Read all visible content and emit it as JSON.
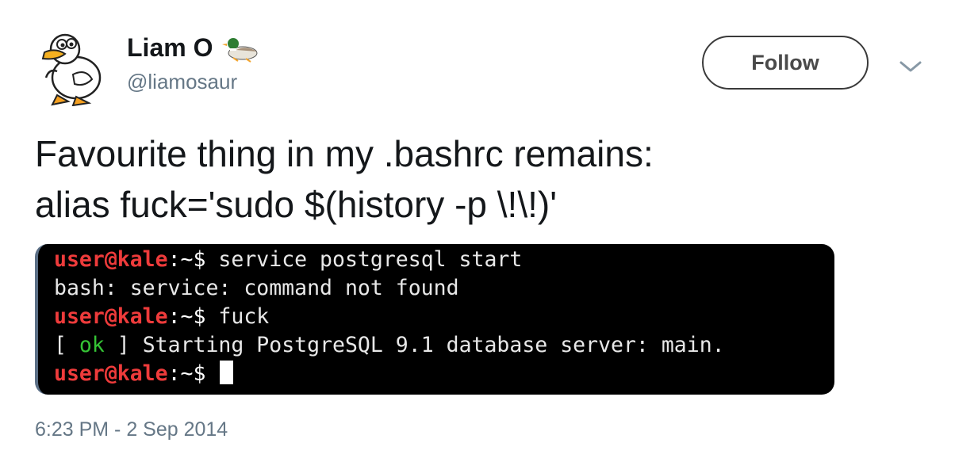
{
  "author": {
    "name": "Liam O",
    "handle": "@liamosaur",
    "avatar_icon": "cartoon-duck-avatar",
    "name_emoji_icon": "duck-emoji-icon"
  },
  "actions": {
    "follow_label": "Follow",
    "more_icon": "chevron-down-icon"
  },
  "tweet": {
    "line1": "Favourite thing in my .bashrc remains:",
    "line2": "alias fuck='sudo $(history -p \\!\\!)'"
  },
  "terminal": {
    "prompt_user": "user@kale",
    "prompt_path": ":~$",
    "line1_cmd": " service postgresql start",
    "line2_out": "bash: service: command not found",
    "line3_cmd": " fuck",
    "line4_open": "[ ",
    "line4_ok": "ok",
    "line4_rest": " ] Starting PostgreSQL 9.1 database server: main.",
    "colors": {
      "user": "#ee3b3b",
      "ok": "#35c335",
      "background": "#000000"
    }
  },
  "timestamp": "6:23 PM - 2 Sep 2014"
}
